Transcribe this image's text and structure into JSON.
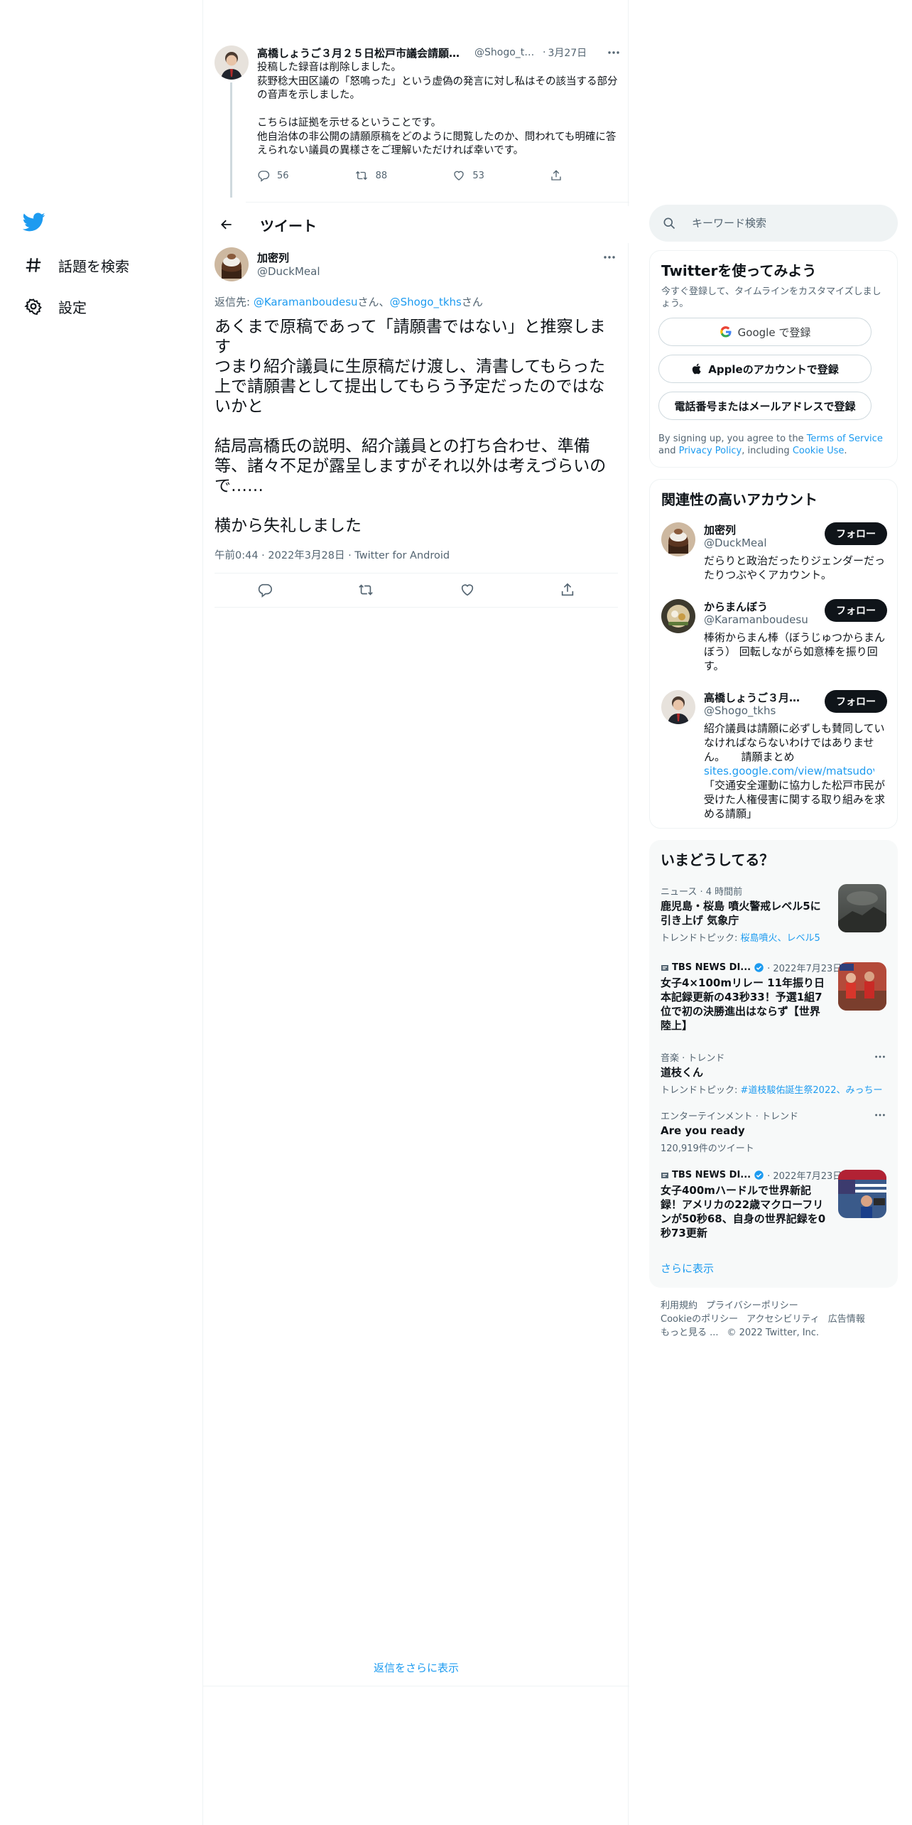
{
  "nav": {
    "explore_label": "話題を検索",
    "settings_label": "設定"
  },
  "prev_tweet": {
    "name": "高橋しょうご３月２５日松戸市議会請願審...",
    "handle": "@Shogo_tk...",
    "dot": "·",
    "date": "3月27日",
    "text": "投稿した録音は削除しました。\n荻野稔大田区議の「怒鳴った」という虚偽の発言に対し私はその該当する部分の音声を示しました。\n\nこちらは証拠を示せるということです。\n他自治体の非公開の請願原稿をどのように閲覧したのか、問われても明確に答えられない議員の異様さをご理解いただければ幸いです。",
    "reply_count": "56",
    "retweet_count": "88",
    "like_count": "53"
  },
  "header": {
    "title": "ツイート"
  },
  "tweet": {
    "name": "加密列",
    "handle": "@DuckMeal",
    "reply_prefix": "返信先: ",
    "reply_user1": "@Karamanboudesu",
    "reply_mid": "さん、",
    "reply_user2": "@Shogo_tkhs",
    "reply_suffix": "さん",
    "text": "あくまで原稿であって「請願書ではない」と推察します\nつまり紹介議員に生原稿だけ渡し、清書してもらった上で請願書として提出してもらう予定だったのではないかと\n\n結局高橋氏の説明、紹介議員との打ち合わせ、準備等、諸々不足が露呈しますがそれ以外は考えづらいので……\n\n横から失礼しました",
    "time": "午前0:44",
    "date": "2022年3月28日",
    "source": "Twitter for Android",
    "dot": "·"
  },
  "show_more_replies": "返信をさらに表示",
  "search": {
    "placeholder": "キーワード検索"
  },
  "join": {
    "title": "Twitterを使ってみよう",
    "subtitle": "今すぐ登録して、タイムラインをカスタマイズしましょう。",
    "google_label": "Google で登録",
    "apple_label": "Appleのアカウントで登録",
    "phone_label": "電話番号またはメールアドレスで登録",
    "legal_1": "By signing up, you agree to the ",
    "terms": "Terms of Service",
    "legal_2": " and ",
    "privacy": "Privacy Policy",
    "legal_3": ", including ",
    "cookie": "Cookie Use",
    "legal_4": "."
  },
  "who_to_follow": {
    "title": "関連性の高いアカウント",
    "follow_label": "フォロー",
    "accounts": [
      {
        "name": "加密列",
        "handle": "@DuckMeal",
        "bio": "だらりと政治だったりジェンダーだったりつぶやくアカウント。"
      },
      {
        "name": "からまんぼう",
        "handle": "@Karamanboudesu",
        "bio": "棒術からまん棒（ぼうじゅつからまんぼう） 回転しながら如意棒を振り回す。"
      },
      {
        "name": "高橋しょうご３月２...",
        "handle": "@Shogo_tkhs",
        "bio_1": "紹介議員は請願に必ずしも賛同していなければならないわけではありません。　　請願まとめ",
        "bio_link": "sites.google.com/view/matsudovt...",
        "bio_2": "「交通安全運動に協力した松戸市民が受けた人権侵害に関する取り組みを求める請願」"
      }
    ]
  },
  "trends": {
    "title": "いまどうしてる？",
    "items": [
      {
        "meta": "ニュース · 4 時間前",
        "title": "鹿児島・桜島 噴火警戒レベル5に引き上げ 気象庁",
        "sub_prefix": "トレンドトピック: ",
        "sub_link": "桜島噴火、レベル5"
      },
      {
        "source": "TBS NEWS DI...",
        "date": "· 2022年7月23日",
        "title": "女子4×100mリレー 11年振り日本記録更新の43秒33！予選1組7位で初の決勝進出はならず【世界陸上】"
      },
      {
        "meta": "音楽 · トレンド",
        "title": "道枝くん",
        "sub_prefix": "トレンドトピック: ",
        "sub_link": "#道枝駿佑誕生祭2022、みっちー"
      },
      {
        "meta": "エンターテインメント · トレンド",
        "title": "Are you ready",
        "sub": "120,919件のツイート"
      },
      {
        "source": "TBS NEWS DI...",
        "date": "· 2022年7月23日",
        "title": "女子400mハードルで世界新記録！アメリカの22歳マクローフリンが50秒68、自身の世界記録を0秒73更新"
      }
    ],
    "show_more": "さらに表示"
  },
  "footer": {
    "terms": "利用規約",
    "privacy": "プライバシーポリシー",
    "cookie": "Cookieのポリシー",
    "accessibility": "アクセシビリティ",
    "ads": "広告情報",
    "more": "もっと見る ...",
    "copyright": "© 2022 Twitter, Inc."
  },
  "colors": {
    "accent": "#1d9bf0",
    "text": "#0f1419",
    "muted": "#536471"
  }
}
